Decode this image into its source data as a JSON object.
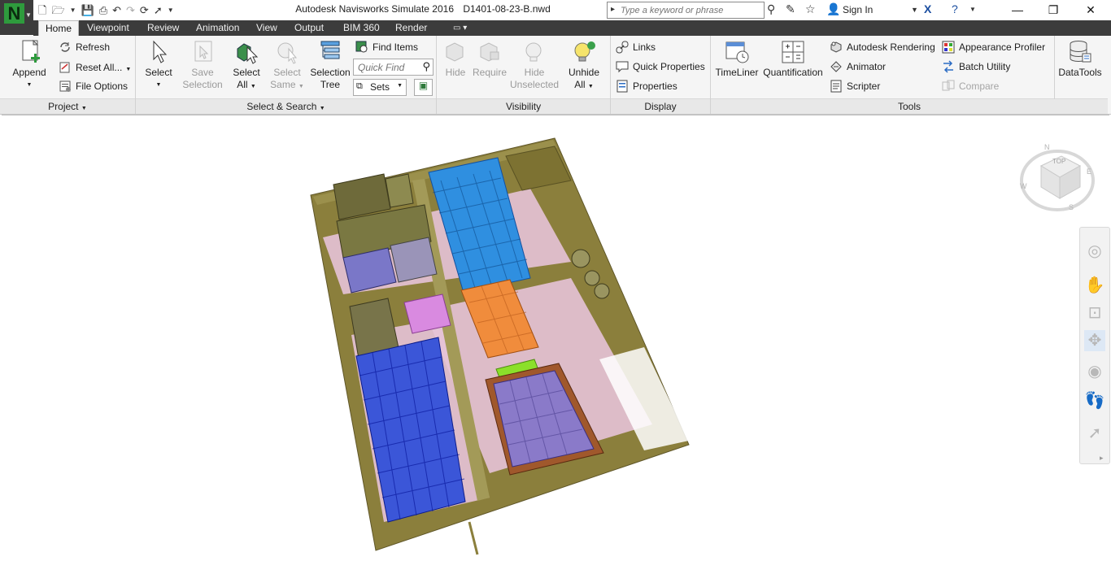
{
  "app": {
    "name": "Autodesk Navisworks Simulate 2016",
    "file": "D1401-08-23-B.nwd",
    "logo_letter": "N"
  },
  "search": {
    "placeholder": "Type a keyword or phrase"
  },
  "account": {
    "signin_label": "Sign In"
  },
  "tabs": [
    {
      "label": "Home",
      "active": true
    },
    {
      "label": "Viewpoint"
    },
    {
      "label": "Review"
    },
    {
      "label": "Animation"
    },
    {
      "label": "View"
    },
    {
      "label": "Output"
    },
    {
      "label": "BIM 360"
    },
    {
      "label": "Render"
    }
  ],
  "ribbon": {
    "project": {
      "title": "Project",
      "append": "Append",
      "refresh": "Refresh",
      "reset_all": "Reset All...",
      "file_options": "File Options"
    },
    "select_search": {
      "title": "Select & Search",
      "select": "Select",
      "save_selection": [
        "Save",
        "Selection"
      ],
      "select_all": [
        "Select",
        "All"
      ],
      "select_same": [
        "Select",
        "Same"
      ],
      "selection_tree": [
        "Selection",
        "Tree"
      ],
      "find_items": "Find Items",
      "quick_find_placeholder": "Quick Find",
      "sets": "Sets"
    },
    "visibility": {
      "title": "Visibility",
      "hide": "Hide",
      "require": "Require",
      "hide_unselected": [
        "Hide",
        "Unselected"
      ],
      "unhide_all": [
        "Unhide",
        "All"
      ]
    },
    "display": {
      "title": "Display",
      "links": "Links",
      "quick_properties": "Quick Properties",
      "properties": "Properties"
    },
    "tools": {
      "title": "Tools",
      "timeliner": "TimeLiner",
      "quantification": "Quantification",
      "autodesk_rendering": "Autodesk Rendering",
      "animator": "Animator",
      "scripter": "Scripter",
      "appearance_profiler": "Appearance Profiler",
      "batch_utility": "Batch Utility",
      "compare": "Compare"
    },
    "datatools": {
      "label": "DataTools"
    }
  },
  "viewcube": {
    "face": "TOP",
    "compass": [
      "N",
      "E",
      "S",
      "W"
    ]
  },
  "colors": {
    "site_ground": "#8b7f3c",
    "site_pink": "#e6c3d7",
    "blue_building": "#2f8fe0",
    "blue_grid": "#1f3cd6",
    "orange_building": "#f08c3c",
    "magenta_building": "#d98ae0",
    "purple_building": "#8a7ac9",
    "brown_frame": "#a0582c",
    "green_accent": "#8be02a"
  }
}
